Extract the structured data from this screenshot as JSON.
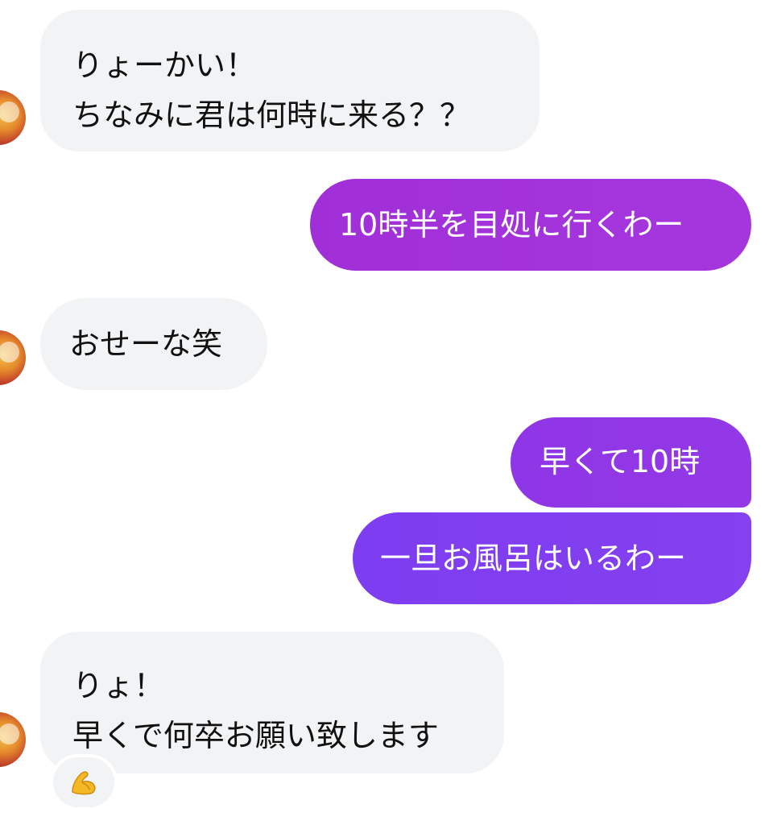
{
  "colors": {
    "incoming_bubble": "#f1f3f5",
    "outgoing_top": "#a233dd",
    "outgoing_bottom": "#7b3cf0",
    "text_dark": "#111111",
    "text_light": "#ffffff"
  },
  "messages": [
    {
      "id": "m1",
      "direction": "incoming",
      "lines": [
        "りょーかい！",
        "ちなみに君は何時に来る？？"
      ]
    },
    {
      "id": "m2",
      "direction": "outgoing",
      "lines": [
        "10時半を目処に行くわー"
      ]
    },
    {
      "id": "m3",
      "direction": "incoming",
      "lines": [
        "おせーな笑"
      ]
    },
    {
      "id": "m4",
      "direction": "outgoing",
      "lines": [
        "早くて10時"
      ]
    },
    {
      "id": "m5",
      "direction": "outgoing",
      "lines": [
        "一旦お風呂はいるわー"
      ]
    },
    {
      "id": "m6",
      "direction": "incoming",
      "lines": [
        "りょ！",
        "早くで何卒お願い致します"
      ]
    }
  ],
  "reaction": {
    "icon": "flexed-biceps-icon"
  }
}
